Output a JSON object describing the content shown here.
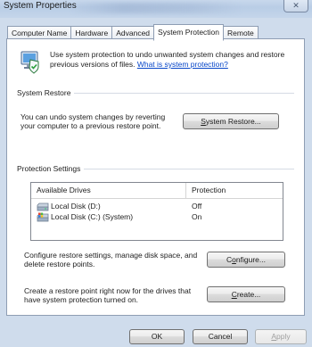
{
  "window": {
    "title": "System Properties",
    "close_glyph": "✕"
  },
  "tabs": [
    {
      "label": "Computer Name"
    },
    {
      "label": "Hardware"
    },
    {
      "label": "Advanced"
    },
    {
      "label": "System Protection",
      "active": true
    },
    {
      "label": "Remote"
    }
  ],
  "intro": {
    "icon": "system-protection-icon",
    "text": "Use system protection to undo unwanted system changes and restore previous versions of files.",
    "link": "What is system protection?"
  },
  "system_restore": {
    "group_label": "System Restore",
    "description": "You can undo system changes by reverting your computer to a previous restore point.",
    "button_label": "System Restore...",
    "button_underline": "S"
  },
  "protection_settings": {
    "group_label": "Protection Settings",
    "columns": [
      "Available Drives",
      "Protection"
    ],
    "drives": [
      {
        "name": "Local Disk (D:)",
        "protection": "Off",
        "icon": "hard-drive-icon"
      },
      {
        "name": "Local Disk (C:) (System)",
        "protection": "On",
        "icon": "system-drive-icon"
      }
    ],
    "configure_text": "Configure restore settings, manage disk space, and delete restore points.",
    "configure_button": "Configure...",
    "configure_underline": "o",
    "create_text": "Create a restore point right now for the drives that have system protection turned on.",
    "create_button": "Create...",
    "create_underline": "C"
  },
  "footer": {
    "ok": "OK",
    "cancel": "Cancel",
    "apply": "Apply",
    "apply_underline": "A"
  },
  "colors": {
    "window_frame": "#cfdcec",
    "link": "#0645c8",
    "panel_border": "#8e9db3"
  }
}
